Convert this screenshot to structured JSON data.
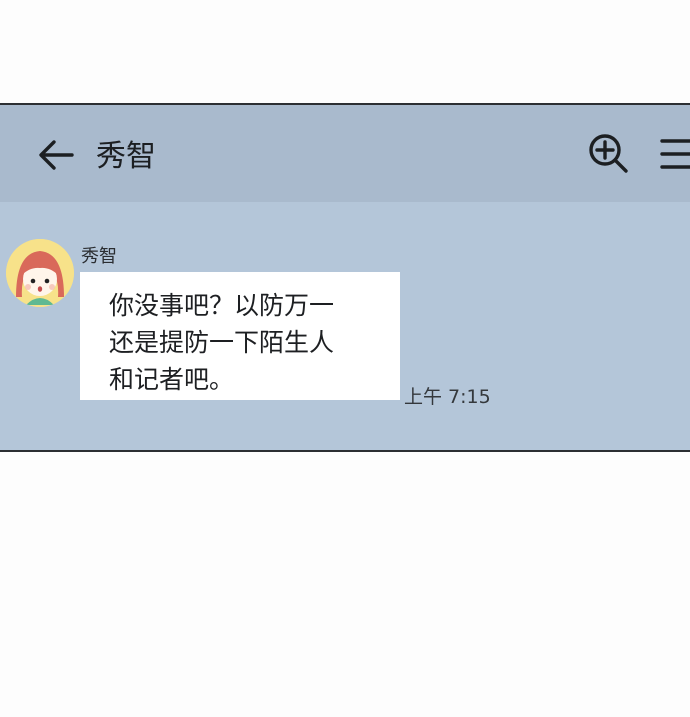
{
  "header": {
    "title": "秀智",
    "back_icon": "arrow-left-icon",
    "search_icon": "zoom-in-icon",
    "menu_icon": "hamburger-menu-icon"
  },
  "message": {
    "sender": "秀智",
    "lines": [
      "你没事吧？以防万一",
      "还是提防一下陌生人",
      "和记者吧。"
    ],
    "time": "上午 7:15"
  },
  "colors": {
    "header_bg": "#a9bacd",
    "chat_bg": "#b4c6d9",
    "bubble_bg": "#ffffff",
    "avatar_bg": "#f7e28a"
  }
}
